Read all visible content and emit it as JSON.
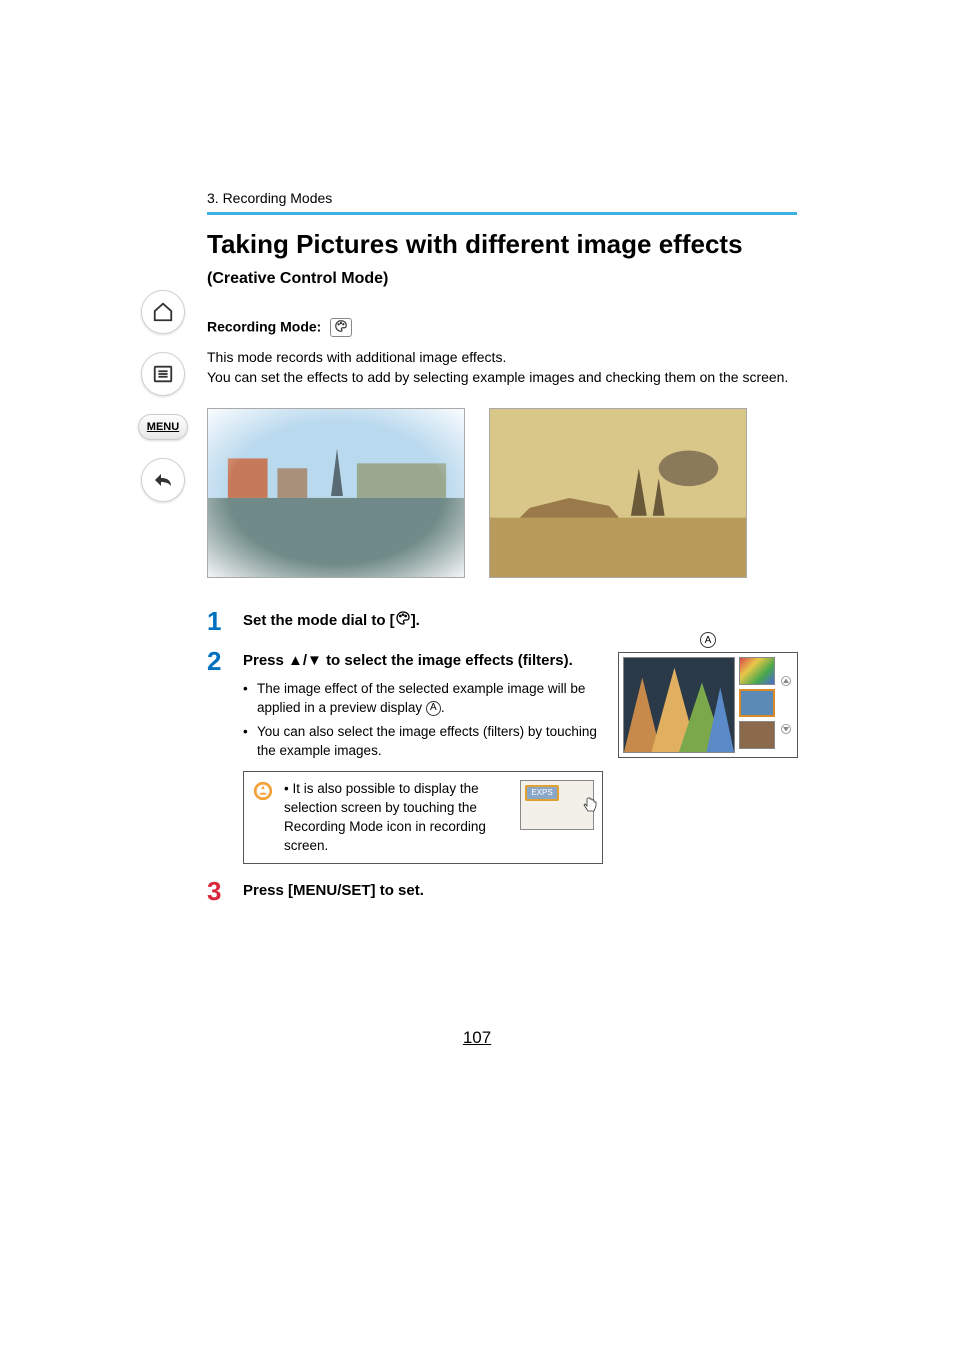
{
  "breadcrumb": "3. Recording Modes",
  "title": "Taking Pictures with different image effects",
  "subtitle": "(Creative Control Mode)",
  "recording_mode_label": "Recording Mode:",
  "description": "This mode records with additional image effects.\nYou can set the effects to add by selecting example images and checking them on the screen.",
  "sidebar": {
    "menu_label": "MENU"
  },
  "steps": [
    {
      "num": "1",
      "color": "blue",
      "title_prefix": "Set the mode dial to [",
      "title_suffix": "].",
      "bullets": [],
      "tip": null
    },
    {
      "num": "2",
      "color": "blue",
      "title": "Press ▲/▼ to select the image effects (filters).",
      "bullets": [
        {
          "pre": "The image effect of the selected example image will be applied in a preview display ",
          "ref": "A",
          "post": "."
        },
        {
          "pre": "You can also select the image effects (filters) by touching the example images.",
          "ref": null,
          "post": ""
        }
      ],
      "tip": {
        "text": "It is also possible to display the selection screen by touching the Recording Mode icon in recording screen.",
        "badge": "EXPS"
      }
    },
    {
      "num": "3",
      "color": "red",
      "title": "Press [MENU/SET] to set.",
      "bullets": [],
      "tip": null
    }
  ],
  "preview_label": "A",
  "page_number": "107"
}
